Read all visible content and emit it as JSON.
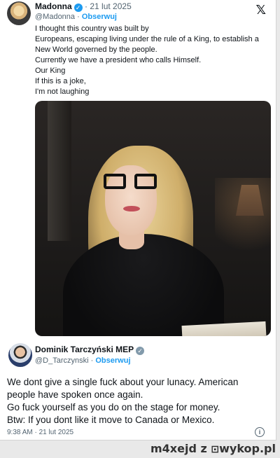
{
  "quoted_tweet": {
    "author_name": "Madonna",
    "date": "21 lut 2025",
    "handle": "@Madonna",
    "follow_label": "Obserwuj",
    "lines": [
      "I thought this country was built by",
      "Europeans, escaping living under the rule of a King, to establish a",
      "New World governed by the people.",
      "Currently we have a president who calls Himself.",
      "Our King",
      "If this is a joke,",
      "I'm not laughing"
    ]
  },
  "x_logo_icon": "x-logo-icon",
  "reply_tweet": {
    "author_name": "Dominik Tarczyński MEP",
    "handle": "@D_Tarczynski",
    "follow_label": "Obserwuj",
    "lines": [
      "We dont give a single fuck about your lunacy. American",
      "people have spoken once again.",
      "Go fuck yourself as you do on the stage for money.",
      "Btw: If you dont like it move to Canada or Mexico."
    ],
    "timestamp": "9:38 AM · 21 lut 2025"
  },
  "watermark": {
    "user": "m4xejd",
    "separator": "z",
    "site": "wykop.pl"
  },
  "colors": {
    "accent": "#1d9bf0",
    "text": "#0f1419",
    "secondary": "#536471"
  }
}
